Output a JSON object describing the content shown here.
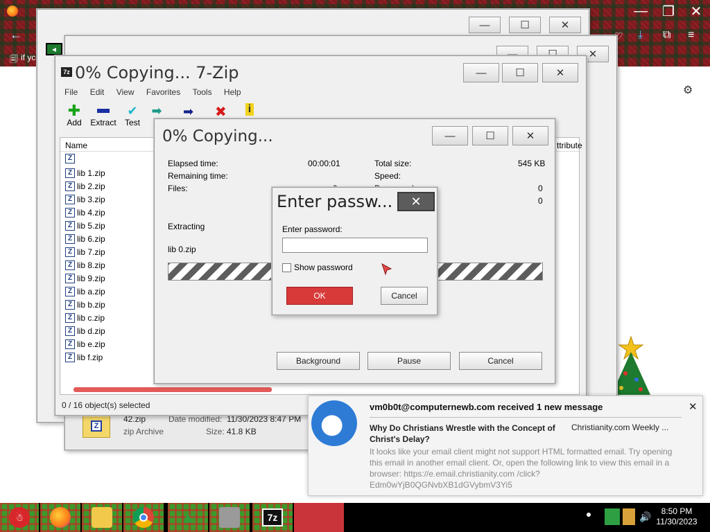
{
  "browser": {
    "tab_text": "if yc",
    "help_glyph": "?"
  },
  "main_window": {
    "title": "0% Copying... 7-Zip",
    "menu": [
      "File",
      "Edit",
      "View",
      "Favorites",
      "Tools",
      "Help"
    ],
    "toolbar": [
      {
        "label": "Add",
        "icon": "plus-icon",
        "color": "#1aa31a"
      },
      {
        "label": "Extract",
        "icon": "minus-icon",
        "color": "#1a2fa3"
      },
      {
        "label": "Test",
        "icon": "check-icon",
        "color": "#1fb8c9"
      },
      {
        "label": "C",
        "icon": "copy-arrow-icon",
        "color": "#1f9a8a"
      }
    ],
    "column_name": "Name",
    "column_attributes": "ttribute",
    "files": [
      "",
      "lib 1.zip",
      "lib 2.zip",
      "lib 3.zip",
      "lib 4.zip",
      "lib 5.zip",
      "lib 6.zip",
      "lib 7.zip",
      "lib 8.zip",
      "lib 9.zip",
      "lib a.zip",
      "lib b.zip",
      "lib c.zip",
      "lib d.zip",
      "lib e.zip",
      "lib f.zip"
    ],
    "status": "0 / 16 object(s) selected"
  },
  "file_info": {
    "name": "42.zip",
    "type": "zip Archive",
    "date_label": "Date modified:",
    "date_value": "11/30/2023 8:47 PM",
    "size_label": "Size:",
    "size_value": "41.8 KB"
  },
  "progress_dialog": {
    "title": "0% Copying...",
    "elapsed_label": "Elapsed time:",
    "elapsed_value": "00:00:01",
    "remaining_label": "Remaining time:",
    "files_label": "Files:",
    "files_value": "0",
    "total_size_label": "Total size:",
    "total_size_value": "545 KB",
    "speed_label": "Speed:",
    "processed_label": "Processed:",
    "processed_value": "0",
    "row4_value": "0",
    "action": "Extracting",
    "current_file": "lib 0.zip",
    "background_button": "Background",
    "pause_button": "Pause",
    "cancel_button": "Cancel"
  },
  "password_dialog": {
    "title": "Enter passw...",
    "prompt": "Enter password:",
    "value": "",
    "show_password_label": "Show password",
    "show_password_checked": false,
    "ok_button": "OK",
    "cancel_button": "Cancel"
  },
  "notification": {
    "header": "vm0b0t@computernewb.com received 1 new message",
    "subject": "Why Do Christians Wrestle with the Concept of Christ's Delay?",
    "sender": "Christianity.com Weekly ...",
    "body": "It looks like your email client might not support HTML formatted email. Try opening this email in another email client. Or, open the following link to view this email in a browser: https://e.email.christianity.com /click?Edm0wYjB0QGNvbXB1dGVybmV3Yi5",
    "close_glyph": "✕"
  },
  "taskbar": {
    "time": "8:50 PM",
    "date": "11/30/2023",
    "items": [
      "santa-icon",
      "firefox-icon",
      "file-explorer-icon",
      "chrome-icon",
      "christmas-tree-icon",
      "wall-icon",
      "7zip-icon"
    ],
    "sevenzip_label": "7z"
  },
  "colors": {
    "ok_button": "#d83a3a",
    "accent_blue": "#1f6fc9"
  }
}
